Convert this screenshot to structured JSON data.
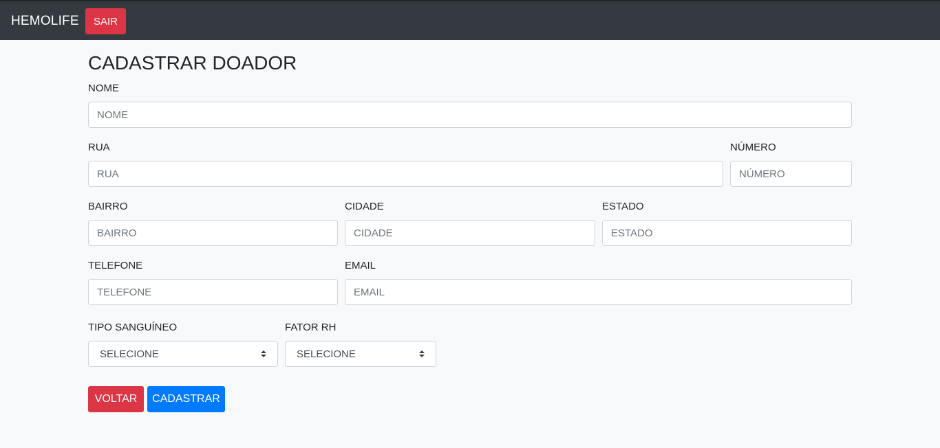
{
  "navbar": {
    "brand": "HEMOLIFE",
    "exit_label": "SAIR",
    "colors": {
      "background": "#343a40",
      "exit": "#dc3545"
    }
  },
  "form": {
    "title": "CADASTRAR DOADOR",
    "fields": {
      "nome": {
        "label": "NOME",
        "placeholder": "NOME",
        "value": ""
      },
      "rua": {
        "label": "RUA",
        "placeholder": "RUA",
        "value": ""
      },
      "numero": {
        "label": "NÚMERO",
        "placeholder": "NÚMERO",
        "value": ""
      },
      "bairro": {
        "label": "BAIRRO",
        "placeholder": "BAIRRO",
        "value": ""
      },
      "cidade": {
        "label": "CIDADE",
        "placeholder": "CIDADE",
        "value": ""
      },
      "estado": {
        "label": "ESTADO",
        "placeholder": "ESTADO",
        "value": ""
      },
      "telefone": {
        "label": "TELEFONE",
        "placeholder": "TELEFONE",
        "value": ""
      },
      "email": {
        "label": "EMAIL",
        "placeholder": "EMAIL",
        "value": ""
      },
      "tipo_sanguineo": {
        "label": "TIPO SANGUÍNEO",
        "selected": "SELECIONE"
      },
      "fator_rh": {
        "label": "FATOR RH",
        "selected": "SELECIONE"
      }
    },
    "buttons": {
      "back_label": "VOLTAR",
      "submit_label": "CADASTRAR"
    },
    "colors": {
      "back": "#dc3545",
      "submit": "#007bff"
    }
  },
  "icons": {
    "select_caret": "sort-caret-icon"
  }
}
